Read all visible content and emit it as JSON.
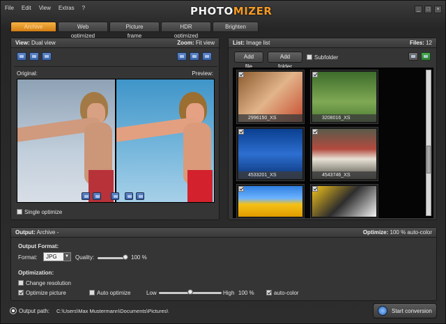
{
  "app": {
    "logo_text_main": "PHOTO",
    "logo_text_accent": "MIZER",
    "menu": [
      "File",
      "Edit",
      "View",
      "Extras",
      "?"
    ],
    "window_controls": [
      "_",
      "□",
      "×"
    ]
  },
  "tabs": [
    {
      "label": "Archive",
      "active": true
    },
    {
      "label": "Web optimized",
      "active": false
    },
    {
      "label": "Picture frame",
      "active": false
    },
    {
      "label": "HDR optimized",
      "active": false
    },
    {
      "label": "Brighten",
      "active": false
    }
  ],
  "view_panel": {
    "view_label": "View:",
    "view_value": "Dual view",
    "zoom_label": "Zoom:",
    "zoom_value": "Fit view",
    "original_label": "Original:",
    "preview_label": "Preview:",
    "single_optimize": "Single optimize"
  },
  "list_panel": {
    "list_label": "List:",
    "list_value": "Image list",
    "files_label": "Files:",
    "files_count": "12",
    "add_file": "Add file",
    "add_folder": "Add folder",
    "subfolder": "Subfolder",
    "thumbnails": [
      {
        "caption": "2996150_XS"
      },
      {
        "caption": "3208016_XS"
      },
      {
        "caption": "4533201_XS"
      },
      {
        "caption": "4543746_XS"
      },
      {
        "caption": ""
      },
      {
        "caption": ""
      }
    ]
  },
  "output_panel": {
    "output_label": "Output:",
    "output_value": "Archive",
    "output_dash": "-",
    "optimize_label": "Optimize:",
    "optimize_value": "100 % auto-color",
    "format_heading": "Output Format:",
    "format_label": "Format:",
    "format_value": "JPG",
    "quality_label": "Quality:",
    "quality_value": "100",
    "quality_unit": "%",
    "quality_level": 1.0,
    "optimization_heading": "Optimization:",
    "change_resolution": "Change resolution",
    "optimize_picture": "Optimize picture",
    "auto_optimize": "Auto optimize",
    "low_label": "Low",
    "high_label": "High",
    "strength_value": "100",
    "strength_unit": "%",
    "strength_level": 0.5,
    "auto_color": "auto-color"
  },
  "footer": {
    "output_path_label": "Output path:",
    "output_path_value": "C:\\Users\\Max Mustermann\\Documents\\Pictures\\",
    "start_button": "Start conversion"
  }
}
